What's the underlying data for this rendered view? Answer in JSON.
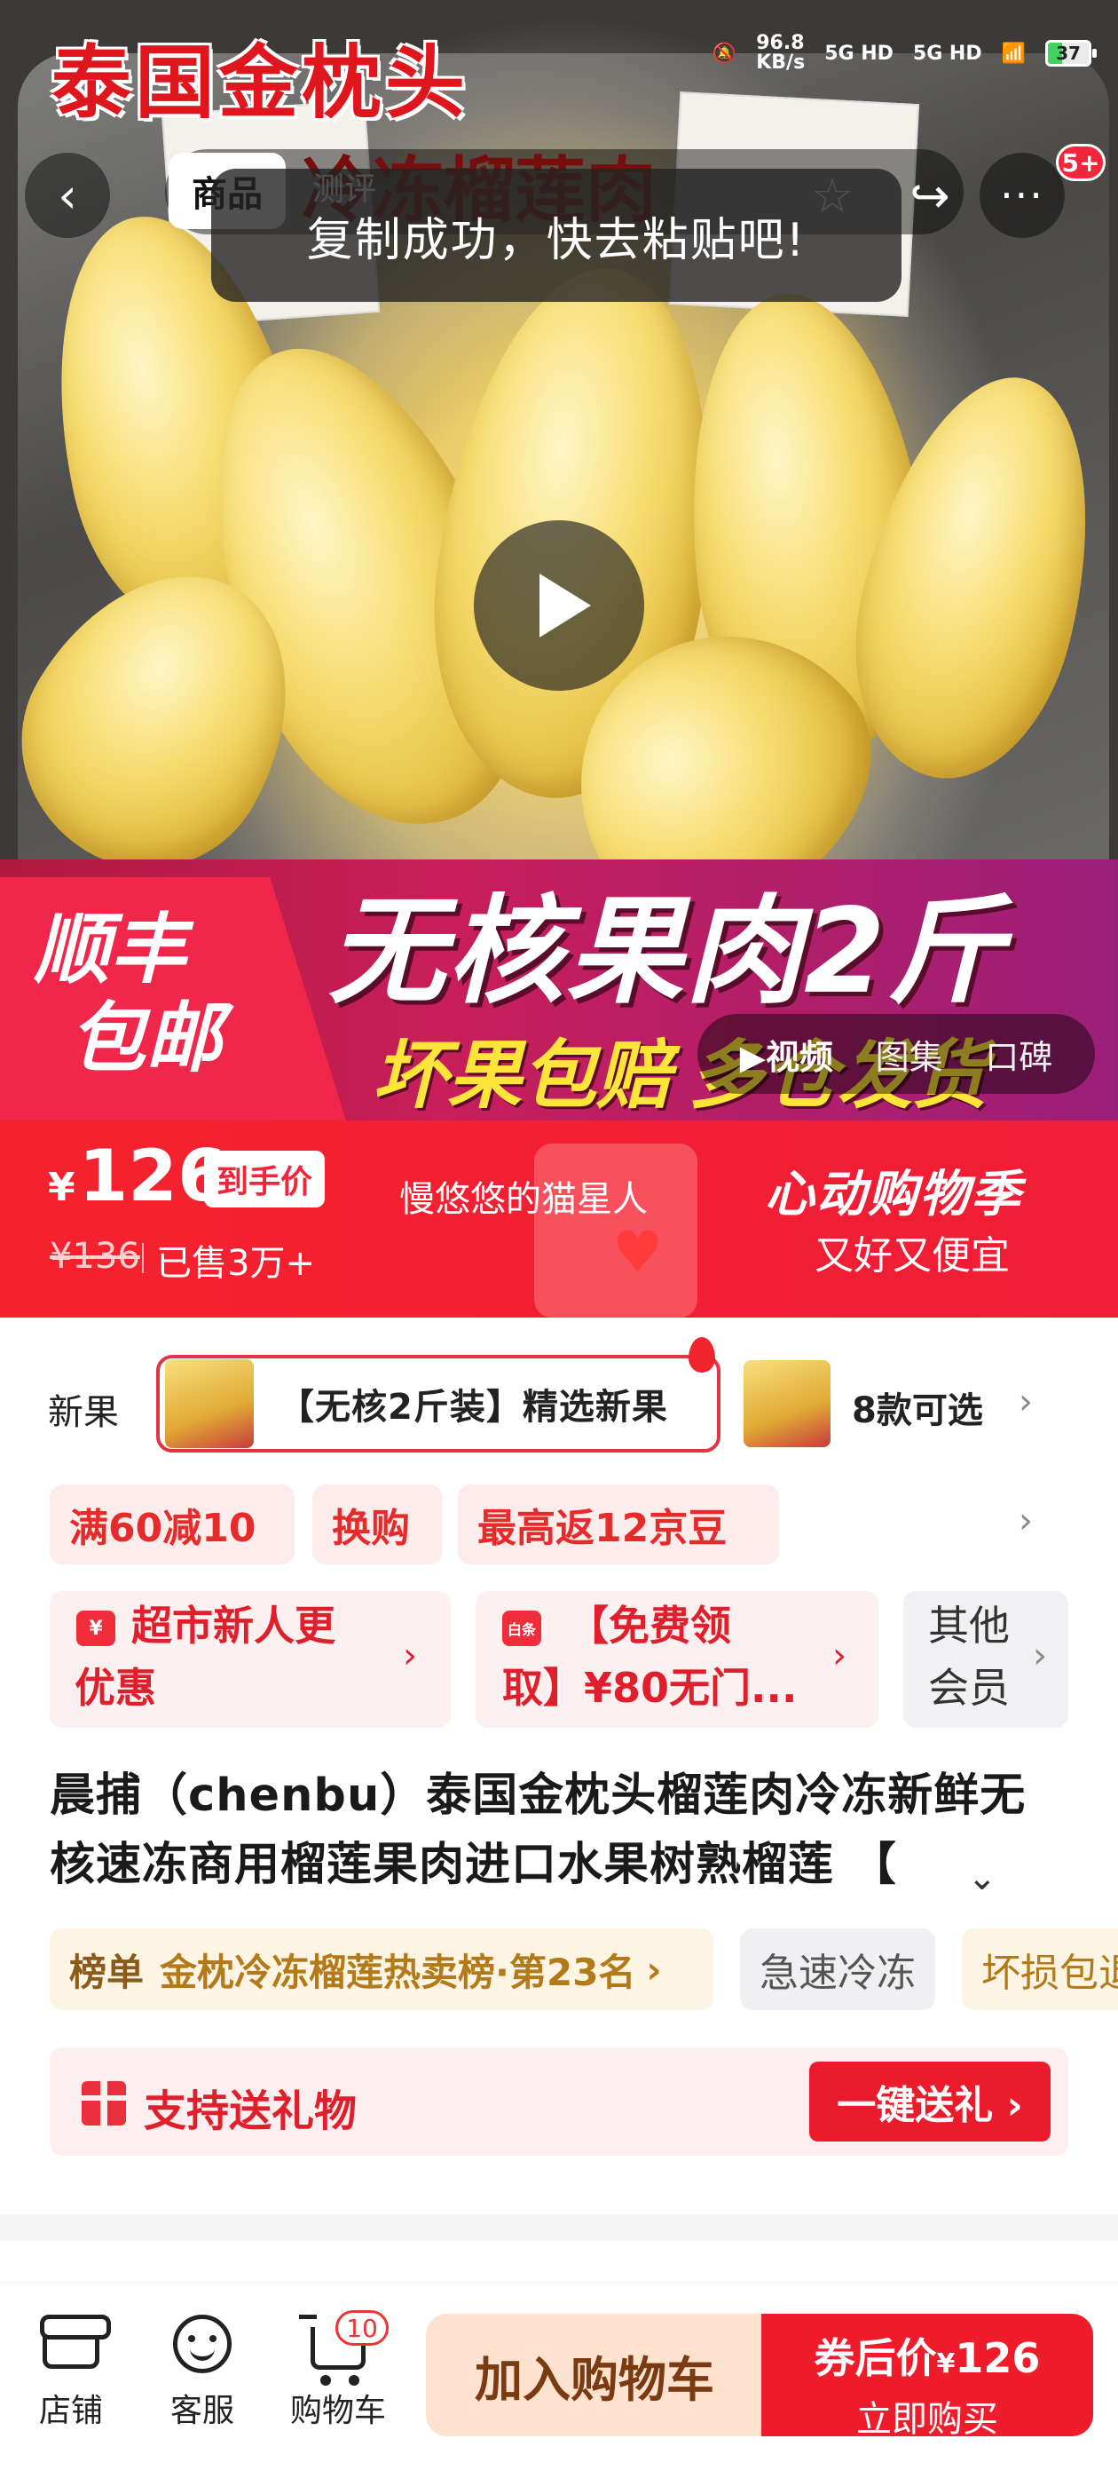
{
  "status_bar": {
    "net_speed_value": "96.8",
    "net_speed_unit": "KB/s",
    "sim1": "5G HD",
    "sim2": "5G HD",
    "battery": "37"
  },
  "hero": {
    "title_overlay": "泰国金枕头",
    "headline_red": "冷冻榴莲肉",
    "banner_left_line1": "顺丰",
    "banner_left_line2": "包邮",
    "banner_headline": "无核果肉2斤",
    "banner_subline": "坏果包赔",
    "banner_subline_tail": "多仓发货"
  },
  "top_nav": {
    "tab_goods": "商品",
    "tab_review": "测评",
    "more_badge": "5+"
  },
  "toast": "复制成功，快去粘贴吧!",
  "media_switch": {
    "video": "▶视频",
    "images": "图集",
    "reviews": "口碑"
  },
  "price_bar": {
    "currency": "¥",
    "price": "126",
    "price_tag": "到手价",
    "original_price": "¥136",
    "sold": "已售3万+",
    "mascot_text": "慢悠悠的猫星人",
    "promo_title": "心动购物季",
    "promo_sub": "又好又便宜"
  },
  "variants": {
    "partial_label": "新果",
    "selected_label": "【无核2斤装】精选新果",
    "count_label": "8款可选"
  },
  "coupons": [
    "满60减10",
    "换购",
    "最高返12京豆"
  ],
  "cards": {
    "new_user_icon": "¥",
    "new_user_line1": "超市新人更",
    "new_user_line2": "优惠",
    "free_icon": "白条",
    "free_line1": "【免费领",
    "free_line2": "取】¥80无门...",
    "member_line1": "其他",
    "member_line2": "会员"
  },
  "product_title_line1": "晨捕（chenbu）泰国金枕头榴莲肉冷冻新鲜无",
  "product_title_line2": "核速冻商用榴莲果肉进口水果树熟榴莲 【",
  "rank": {
    "label": "榜单",
    "text": "金枕冷冻榴莲热卖榜·第23名",
    "arrow": "›"
  },
  "tags": [
    "急速冷冻",
    "坏损包退"
  ],
  "gift": {
    "label": "支持送礼物",
    "button": "一键送礼 ›"
  },
  "bottom_bar": {
    "store": "店铺",
    "service": "客服",
    "cart": "购物车",
    "cart_count": "10",
    "add_to_cart": "加入购物车",
    "buy_price_label": "券后价",
    "buy_currency": "¥",
    "buy_price": "126",
    "buy_now": "立即购买"
  },
  "colors": {
    "accent_red": "#f5222d",
    "price_bar": "#f21f33",
    "add_cart_bg": "#fde2cf"
  }
}
